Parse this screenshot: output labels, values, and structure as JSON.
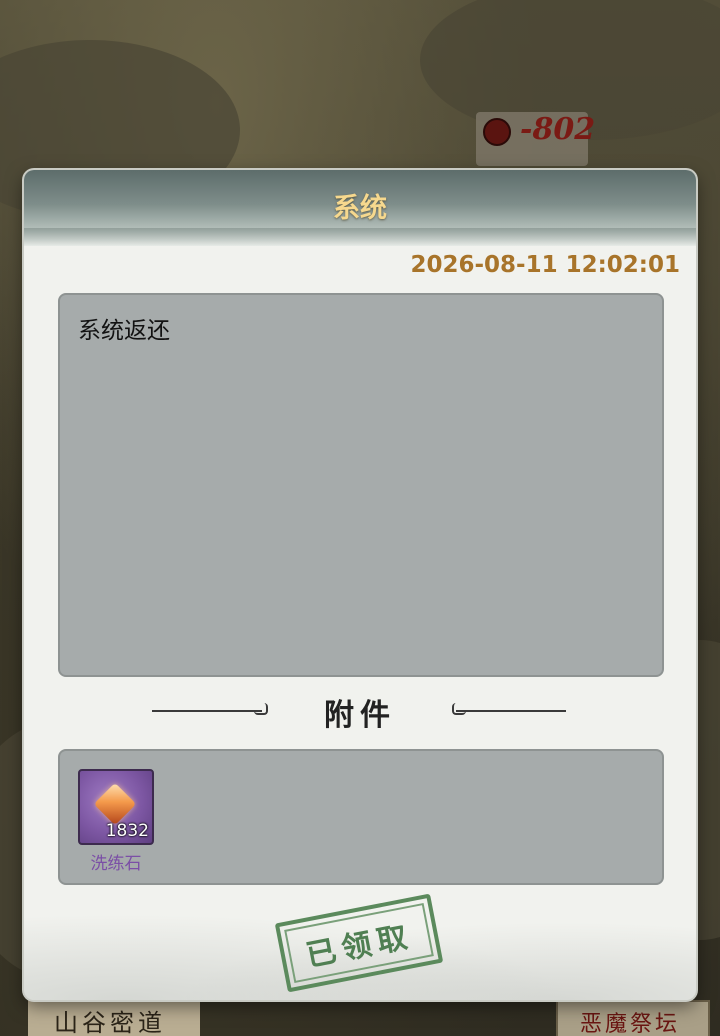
{
  "background": {
    "damage_text": "-802",
    "location_left": "山谷密道",
    "location_right": "恶魔祭坛"
  },
  "modal": {
    "title": "系统",
    "date": "2026-08-11 12:02:01",
    "message": "系统返还",
    "attachments_title": "附件",
    "attachments": [
      {
        "name": "洗练石",
        "count": "1832",
        "icon": "gem-icon",
        "rarity_color": "#7b4fa6"
      }
    ],
    "stamp": "已领取"
  },
  "colors": {
    "title": "#f6d88e",
    "date": "#a8742a",
    "stamp": "#4f7f52"
  }
}
